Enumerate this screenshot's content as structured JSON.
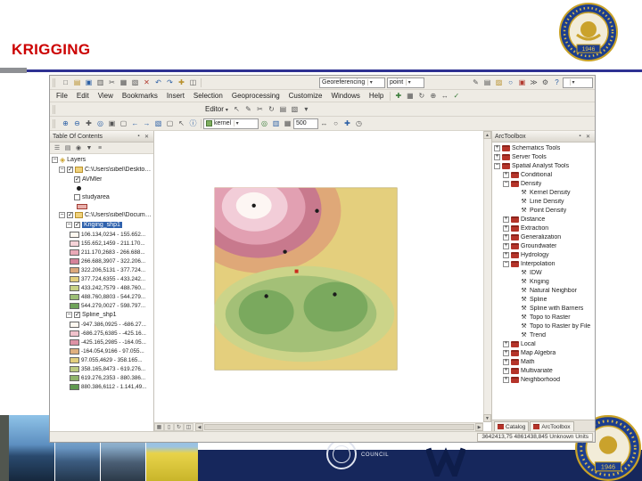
{
  "slide": {
    "title": "KRIGGING",
    "accent_color": "#cc0000",
    "rule_color": "#2e3192",
    "footer_text": "COUNCIL",
    "logo_year": "1946"
  },
  "arcmap": {
    "menus": [
      "File",
      "Edit",
      "View",
      "Bookmarks",
      "Insert",
      "Selection",
      "Geoprocessing",
      "Customize",
      "Windows",
      "Help"
    ],
    "toolbar_top": {
      "icons_left": [
        {
          "name": "new-map-icon",
          "glyph": "□"
        },
        {
          "name": "open-map-icon",
          "glyph": "▤",
          "cls": "c-gold"
        },
        {
          "name": "save-icon",
          "glyph": "▣",
          "cls": "c-blue"
        },
        {
          "name": "print-icon",
          "glyph": "▥"
        },
        {
          "name": "cut-icon",
          "glyph": "✂"
        },
        {
          "name": "copy-icon",
          "glyph": "▦"
        },
        {
          "name": "paste-icon",
          "glyph": "▧"
        },
        {
          "name": "delete-icon",
          "glyph": "✕",
          "cls": "c-red"
        },
        {
          "name": "undo-icon",
          "glyph": "↶",
          "cls": "c-blue"
        },
        {
          "name": "redo-icon",
          "glyph": "↷",
          "cls": "c-blue"
        },
        {
          "name": "add-data-icon",
          "glyph": "✚",
          "cls": "c-gold"
        },
        {
          "name": "scale-combo-icon",
          "glyph": "◫"
        }
      ],
      "georeferencing_label": "Georeferencing",
      "layer_value": "point",
      "icons_right": [
        {
          "name": "editor-toolbar-icon",
          "glyph": "✎"
        },
        {
          "name": "table-of-contents-icon",
          "glyph": "▤"
        },
        {
          "name": "catalog-window-icon",
          "glyph": "▨",
          "cls": "c-gold"
        },
        {
          "name": "search-icon",
          "glyph": "○",
          "cls": "c-blue"
        },
        {
          "name": "arctoolbox-window-icon",
          "glyph": "▣",
          "cls": "c-red"
        },
        {
          "name": "python-window-icon",
          "glyph": "≫"
        },
        {
          "name": "model-builder-icon",
          "glyph": "⚙"
        },
        {
          "name": "help-icon",
          "glyph": "?",
          "cls": "c-blue"
        }
      ]
    },
    "menu_icons": [
      {
        "name": "add-control-points-icon",
        "glyph": "✚",
        "cls": "c-green"
      },
      {
        "name": "link-table-icon",
        "glyph": "▦"
      },
      {
        "name": "rotate-raster-icon",
        "glyph": "↻"
      },
      {
        "name": "zoom-raster-icon",
        "glyph": "⊕"
      },
      {
        "name": "pan-raster-icon",
        "glyph": "↔"
      },
      {
        "name": "auto-adjust-icon",
        "glyph": "✓",
        "cls": "c-green"
      }
    ],
    "editor": {
      "label": "Editor",
      "icons": [
        {
          "name": "edit-tool-icon",
          "glyph": "↖"
        },
        {
          "name": "sketch-tool-icon",
          "glyph": "✎"
        },
        {
          "name": "split-tool-icon",
          "glyph": "✂"
        },
        {
          "name": "rotate-tool-icon",
          "glyph": "↻"
        },
        {
          "name": "attributes-icon",
          "glyph": "▤"
        },
        {
          "name": "sketch-properties-icon",
          "glyph": "▧"
        },
        {
          "name": "editor-more-icon",
          "glyph": "▾"
        }
      ]
    },
    "tools_toolbar": {
      "icons_left": [
        {
          "name": "zoom-in-icon",
          "glyph": "⊕",
          "cls": "c-blue"
        },
        {
          "name": "zoom-out-icon",
          "glyph": "⊖",
          "cls": "c-blue"
        },
        {
          "name": "pan-icon",
          "glyph": "✚"
        },
        {
          "name": "full-extent-icon",
          "glyph": "◎",
          "cls": "c-blue"
        },
        {
          "name": "fixed-zoom-in-icon",
          "glyph": "▣"
        },
        {
          "name": "fixed-zoom-out-icon",
          "glyph": "▢"
        },
        {
          "name": "back-extent-icon",
          "glyph": "←",
          "cls": "c-blue"
        },
        {
          "name": "forward-extent-icon",
          "glyph": "→",
          "cls": "c-blue"
        },
        {
          "name": "select-features-icon",
          "glyph": "▧",
          "cls": "c-blue"
        },
        {
          "name": "clear-selection-icon",
          "glyph": "▢"
        },
        {
          "name": "select-elements-icon",
          "glyph": "↖"
        },
        {
          "name": "identify-icon",
          "glyph": "ⓘ",
          "cls": "c-blue"
        }
      ],
      "layer_label": "kernel",
      "icons_mid": [
        {
          "name": "contour-icon",
          "glyph": "◎",
          "cls": "c-green"
        },
        {
          "name": "histogram-icon",
          "glyph": "▥",
          "cls": "c-blue"
        },
        {
          "name": "raster-calculator-icon",
          "glyph": "▦"
        }
      ],
      "cell_value": "500",
      "icons_right": [
        {
          "name": "measure-icon",
          "glyph": "↔"
        },
        {
          "name": "find-icon",
          "glyph": "○"
        },
        {
          "name": "go-to-xy-icon",
          "glyph": "✚",
          "cls": "c-blue"
        },
        {
          "name": "time-slider-icon",
          "glyph": "◷"
        }
      ]
    },
    "toc": {
      "title": "Table Of Contents",
      "toolbar_icons": [
        {
          "name": "list-by-drawing-order-icon",
          "glyph": "☰"
        },
        {
          "name": "list-by-source-icon",
          "glyph": "▤"
        },
        {
          "name": "list-by-visibility-icon",
          "glyph": "◉"
        },
        {
          "name": "list-by-selection-icon",
          "glyph": "▼"
        },
        {
          "name": "toc-options-icon",
          "glyph": "≡"
        }
      ],
      "layers_label": "Layers",
      "group1_label": "C:\\Users\\sibel\\Desktop\\Yogu",
      "avmler_label": "AVMler",
      "studyarea_label": "studyarea",
      "group2_label": "C:\\Users\\sibel\\Documents\\A",
      "kriging_label": "Kriging_shp1",
      "kriging_classes": [
        {
          "label": "106.134,0234 - 155.652...",
          "color": "#fdf7ef"
        },
        {
          "label": "155.652,1459 - 211.170...",
          "color": "#f5d3d8"
        },
        {
          "label": "211.170,2683 - 266.688...",
          "color": "#e9aab8"
        },
        {
          "label": "266.688,3907 - 322.206...",
          "color": "#d5839a"
        },
        {
          "label": "322.206,5131 - 377.724...",
          "color": "#dca87c"
        },
        {
          "label": "377.724,6355 - 433.242...",
          "color": "#e3cf7e"
        },
        {
          "label": "433.242,7579 - 488.760...",
          "color": "#c8d285"
        },
        {
          "label": "488.760,8803 - 544.279...",
          "color": "#9dbf76"
        },
        {
          "label": "544.279,0027 - 598.797...",
          "color": "#6fa35a"
        }
      ],
      "spline_label": "Spline_shp1",
      "spline_classes": [
        {
          "label": "-947.386,0925 - -686.27...",
          "color": "#fdf7ef"
        },
        {
          "label": "-686.275,6385 - -425.16...",
          "color": "#f0c3cc"
        },
        {
          "label": "-425.165,2985 - -164.05...",
          "color": "#dd92a5"
        },
        {
          "label": "-164.054,9166 - 97.055...",
          "color": "#dfb07f"
        },
        {
          "label": "97.055,4629 - 358.165...",
          "color": "#e3cf7e"
        },
        {
          "label": "358.165,8473 - 619.276...",
          "color": "#bccb82"
        },
        {
          "label": "619.276,2353 - 880.386...",
          "color": "#8fb46c"
        },
        {
          "label": "880.386,6112 - 1.141,49...",
          "color": "#5f9950"
        }
      ]
    },
    "toolbox": {
      "title": "ArcToolbox",
      "rows": [
        {
          "label": "Schematics Tools",
          "name": "toolbox-schematics-tools",
          "ind": "lvl0",
          "exp": "plus",
          "icon": "ibox"
        },
        {
          "label": "Server Tools",
          "name": "toolbox-server-tools",
          "ind": "lvl0",
          "exp": "plus",
          "icon": "ibox"
        },
        {
          "label": "Spatial Analyst Tools",
          "name": "toolbox-spatial-analyst-tools",
          "ind": "lvl0",
          "exp": "minus",
          "icon": "ibox"
        },
        {
          "label": "Conditional",
          "name": "toolset-conditional",
          "ind": "lvl1",
          "exp": "plus",
          "icon": "iset"
        },
        {
          "label": "Density",
          "name": "toolset-density",
          "ind": "lvl1",
          "exp": "minus",
          "icon": "iset"
        },
        {
          "label": "Kernel Density",
          "name": "tool-kernel-density",
          "ind": "lvl2",
          "exp": "leaf",
          "icon": "itool"
        },
        {
          "label": "Line Density",
          "name": "tool-line-density",
          "ind": "lvl2",
          "exp": "leaf",
          "icon": "itool"
        },
        {
          "label": "Point Density",
          "name": "tool-point-density",
          "ind": "lvl2",
          "exp": "leaf",
          "icon": "itool"
        },
        {
          "label": "Distance",
          "name": "toolset-distance",
          "ind": "lvl1",
          "exp": "plus",
          "icon": "iset"
        },
        {
          "label": "Extraction",
          "name": "toolset-extraction",
          "ind": "lvl1",
          "exp": "plus",
          "icon": "iset"
        },
        {
          "label": "Generalization",
          "name": "toolset-generalization",
          "ind": "lvl1",
          "exp": "plus",
          "icon": "iset"
        },
        {
          "label": "Groundwater",
          "name": "toolset-groundwater",
          "ind": "lvl1",
          "exp": "plus",
          "icon": "iset"
        },
        {
          "label": "Hydrology",
          "name": "toolset-hydrology",
          "ind": "lvl1",
          "exp": "plus",
          "icon": "iset"
        },
        {
          "label": "Interpolation",
          "name": "toolset-interpolation",
          "ind": "lvl1",
          "exp": "minus",
          "icon": "iset"
        },
        {
          "label": "IDW",
          "name": "tool-idw",
          "ind": "lvl2",
          "exp": "leaf",
          "icon": "itool"
        },
        {
          "label": "Kriging",
          "name": "tool-kriging",
          "ind": "lvl2",
          "exp": "leaf",
          "icon": "itool"
        },
        {
          "label": "Natural Neighbor",
          "name": "tool-natural-neighbor",
          "ind": "lvl2",
          "exp": "leaf",
          "icon": "itool"
        },
        {
          "label": "Spline",
          "name": "tool-spline",
          "ind": "lvl2",
          "exp": "leaf",
          "icon": "itool"
        },
        {
          "label": "Spline with Barriers",
          "name": "tool-spline-with-barriers",
          "ind": "lvl2",
          "exp": "leaf",
          "icon": "itool"
        },
        {
          "label": "Topo to Raster",
          "name": "tool-topo-to-raster",
          "ind": "lvl2",
          "exp": "leaf",
          "icon": "itool"
        },
        {
          "label": "Topo to Raster by File",
          "name": "tool-topo-to-raster-by-file",
          "ind": "lvl2",
          "exp": "leaf",
          "icon": "itool"
        },
        {
          "label": "Trend",
          "name": "tool-trend",
          "ind": "lvl2",
          "exp": "leaf",
          "icon": "itool"
        },
        {
          "label": "Local",
          "name": "toolset-local",
          "ind": "lvl1",
          "exp": "plus",
          "icon": "iset"
        },
        {
          "label": "Map Algebra",
          "name": "toolset-map-algebra",
          "ind": "lvl1",
          "exp": "plus",
          "icon": "iset"
        },
        {
          "label": "Math",
          "name": "toolset-math",
          "ind": "lvl1",
          "exp": "plus",
          "icon": "iset"
        },
        {
          "label": "Multivariate",
          "name": "toolset-multivariate",
          "ind": "lvl1",
          "exp": "plus",
          "icon": "iset"
        },
        {
          "label": "Neighborhood",
          "name": "toolset-neighborhood",
          "ind": "lvl1",
          "exp": "plus",
          "icon": "iset"
        }
      ],
      "tabs": [
        {
          "label": "Catalog"
        },
        {
          "label": "ArcToolbox"
        }
      ]
    },
    "statusbar": {
      "coords": "3642413,75  4861438,845 Unknown Units",
      "view_icons": [
        {
          "name": "data-view-icon",
          "glyph": "▦"
        },
        {
          "name": "layout-view-icon",
          "glyph": "▯"
        },
        {
          "name": "refresh-view-icon",
          "glyph": "↻"
        },
        {
          "name": "pause-drawing-icon",
          "glyph": "◫"
        }
      ]
    }
  },
  "map": {
    "colors": {
      "bg": "#e4cf7d",
      "ring_tan": "#dfa878",
      "pink_dark": "#c8798d",
      "pink": "#e2a0b2",
      "pink_light": "#f2cdd8",
      "center": "#fdf6f3",
      "green_light": "#ccd489",
      "green": "#a3c077",
      "green_dark": "#7aa95e",
      "dot": "#1c1c1c",
      "marker": "#cc2a1e"
    }
  }
}
